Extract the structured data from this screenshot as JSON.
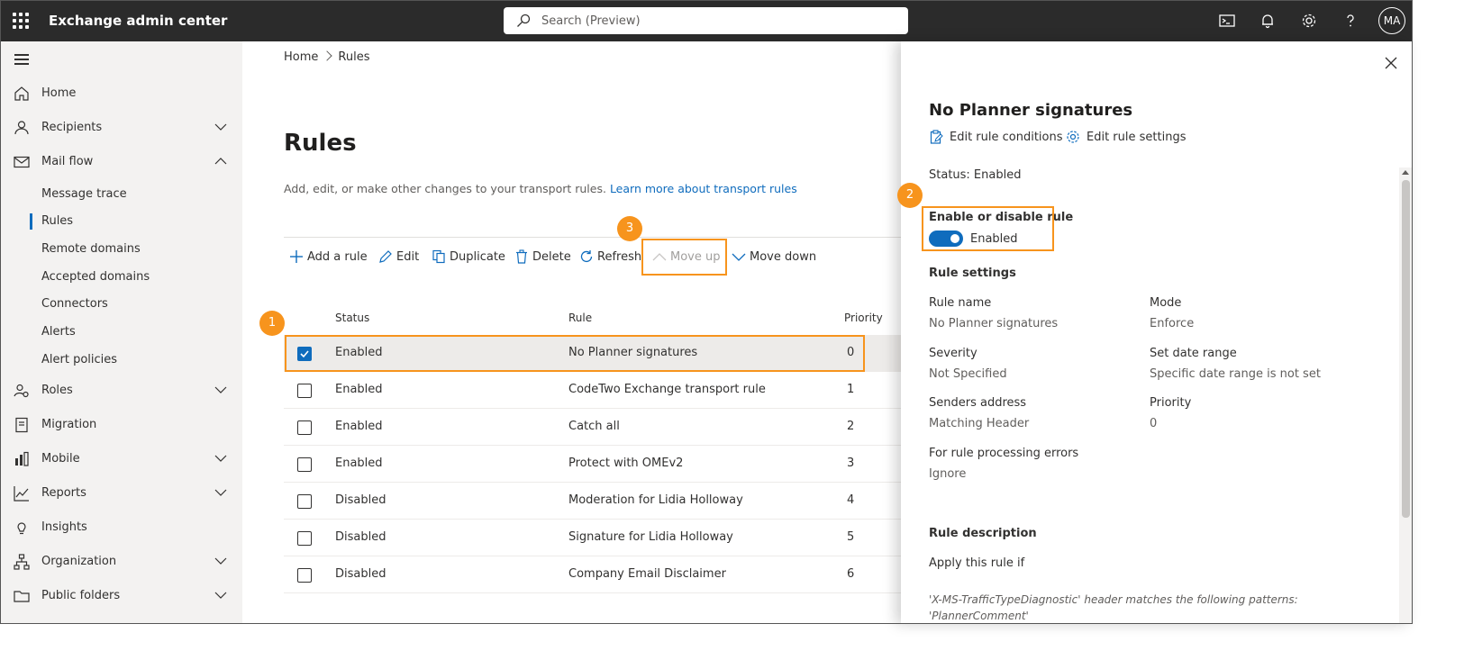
{
  "app": {
    "title": "Exchange admin center"
  },
  "search": {
    "placeholder": "Search (Preview)"
  },
  "user": {
    "initials": "MA"
  },
  "sidebar": {
    "items": [
      {
        "label": "Home",
        "icon": "home-icon",
        "expandable": false
      },
      {
        "label": "Recipients",
        "icon": "person-icon",
        "expandable": true
      },
      {
        "label": "Mail flow",
        "icon": "mail-icon",
        "expandable": true,
        "expanded": true
      },
      {
        "label": "Roles",
        "icon": "roles-icon",
        "expandable": true
      },
      {
        "label": "Migration",
        "icon": "migration-icon",
        "expandable": false
      },
      {
        "label": "Mobile",
        "icon": "mobile-icon",
        "expandable": true
      },
      {
        "label": "Reports",
        "icon": "reports-icon",
        "expandable": true
      },
      {
        "label": "Insights",
        "icon": "lightbulb-icon",
        "expandable": false
      },
      {
        "label": "Organization",
        "icon": "organization-icon",
        "expandable": true
      },
      {
        "label": "Public folders",
        "icon": "folder-icon",
        "expandable": true
      }
    ],
    "mailflow_sub": [
      {
        "label": "Message trace"
      },
      {
        "label": "Rules",
        "active": true
      },
      {
        "label": "Remote domains"
      },
      {
        "label": "Accepted domains"
      },
      {
        "label": "Connectors"
      },
      {
        "label": "Alerts"
      },
      {
        "label": "Alert policies"
      }
    ]
  },
  "breadcrumb": {
    "home": "Home",
    "current": "Rules"
  },
  "page": {
    "title": "Rules",
    "description": "Add, edit, or make other changes to your transport rules.",
    "learn_more": "Learn more about transport rules"
  },
  "toolbar": {
    "add": "Add a rule",
    "edit": "Edit",
    "duplicate": "Duplicate",
    "delete": "Delete",
    "refresh": "Refresh",
    "move_up": "Move up",
    "move_down": "Move down"
  },
  "table": {
    "columns": {
      "status": "Status",
      "rule": "Rule",
      "priority": "Priority"
    },
    "rows": [
      {
        "status": "Enabled",
        "rule": "No Planner signatures",
        "priority": "0",
        "selected": true
      },
      {
        "status": "Enabled",
        "rule": "CodeTwo Exchange transport rule",
        "priority": "1",
        "selected": false
      },
      {
        "status": "Enabled",
        "rule": "Catch all",
        "priority": "2",
        "selected": false
      },
      {
        "status": "Enabled",
        "rule": "Protect with OMEv2",
        "priority": "3",
        "selected": false
      },
      {
        "status": "Disabled",
        "rule": "Moderation for Lidia Holloway",
        "priority": "4",
        "selected": false
      },
      {
        "status": "Disabled",
        "rule": "Signature for Lidia Holloway",
        "priority": "5",
        "selected": false
      },
      {
        "status": "Disabled",
        "rule": "Company Email Disclaimer",
        "priority": "6",
        "selected": false
      }
    ]
  },
  "callouts": {
    "one": "1",
    "two": "2",
    "three": "3"
  },
  "panel": {
    "title": "No Planner signatures",
    "edit_conditions": "Edit rule conditions",
    "edit_settings": "Edit rule settings",
    "status": "Status: Enabled",
    "toggle_heading": "Enable or disable rule",
    "toggle_state": "Enabled",
    "toggle_on": true,
    "settings_heading": "Rule settings",
    "fields": {
      "rule_name_label": "Rule name",
      "rule_name": "No Planner signatures",
      "mode_label": "Mode",
      "mode": "Enforce",
      "severity_label": "Severity",
      "severity": "Not Specified",
      "date_range_label": "Set date range",
      "date_range": "Specific date range is not set",
      "senders_label": "Senders address",
      "senders": "Matching Header",
      "priority_label": "Priority",
      "priority": "0",
      "errors_label": "For rule processing errors",
      "errors": "Ignore"
    },
    "description_heading": "Rule description",
    "apply_if": "Apply this rule if",
    "condition_line1": "'X-MS-TrafficTypeDiagnostic' header matches the following patterns:",
    "condition_line2": "'PlannerComment'"
  },
  "colors": {
    "accent": "#0f6cbd",
    "callout": "#f7941d",
    "topbar": "#2b2b2b"
  }
}
